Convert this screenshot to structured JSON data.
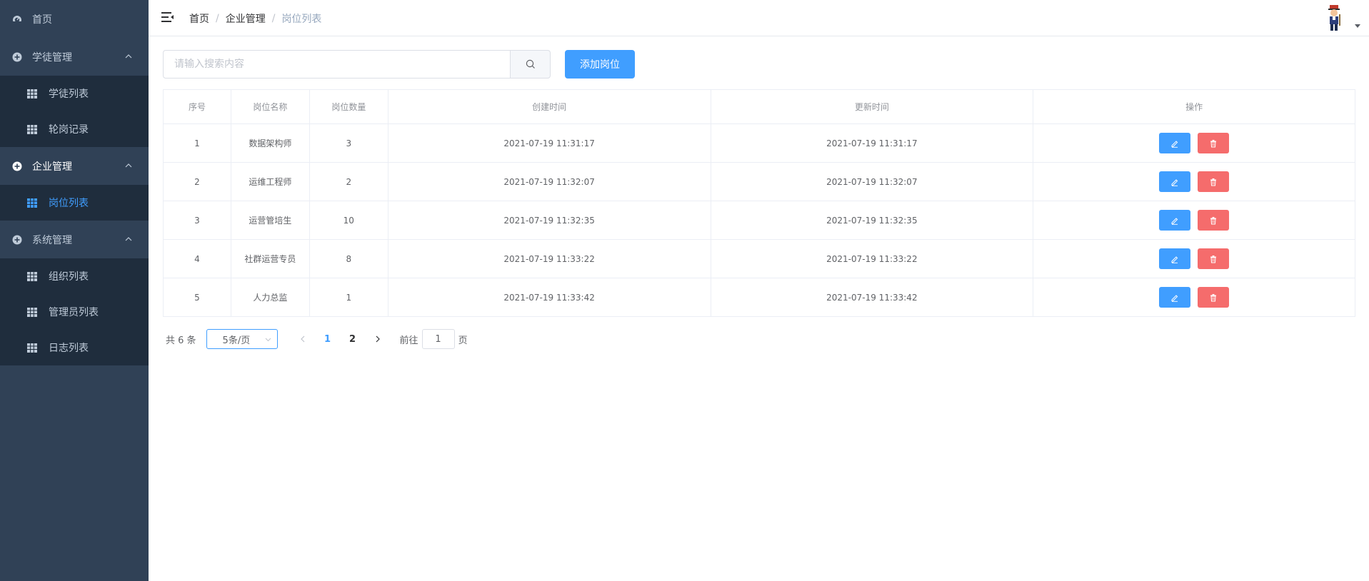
{
  "sidebar": {
    "home": {
      "label": "首页",
      "icon": "dashboard-icon"
    },
    "groups": [
      {
        "label": "学徒管理",
        "icon": "circle-plus-icon",
        "items": [
          {
            "label": "学徒列表",
            "icon": "table-icon"
          },
          {
            "label": "轮岗记录",
            "icon": "table-icon"
          }
        ]
      },
      {
        "label": "企业管理",
        "icon": "circle-plus-icon",
        "items": [
          {
            "label": "岗位列表",
            "icon": "table-icon",
            "active": true
          }
        ]
      },
      {
        "label": "系统管理",
        "icon": "circle-plus-icon",
        "items": [
          {
            "label": "组织列表",
            "icon": "table-icon"
          },
          {
            "label": "管理员列表",
            "icon": "table-icon"
          },
          {
            "label": "日志列表",
            "icon": "table-icon"
          }
        ]
      }
    ]
  },
  "breadcrumb": {
    "items": [
      "首页",
      "企业管理",
      "岗位列表"
    ],
    "separator": "/"
  },
  "search": {
    "placeholder": "请输入搜索内容",
    "value": ""
  },
  "toolbar": {
    "add_label": "添加岗位"
  },
  "table": {
    "headers": [
      "序号",
      "岗位名称",
      "岗位数量",
      "创建时间",
      "更新时间",
      "操作"
    ],
    "rows": [
      [
        "1",
        "数据架构师",
        "3",
        "2021-07-19 11:31:17",
        "2021-07-19 11:31:17"
      ],
      [
        "2",
        "运维工程师",
        "2",
        "2021-07-19 11:32:07",
        "2021-07-19 11:32:07"
      ],
      [
        "3",
        "运营管培生",
        "10",
        "2021-07-19 11:32:35",
        "2021-07-19 11:32:35"
      ],
      [
        "4",
        "社群运营专员",
        "8",
        "2021-07-19 11:33:22",
        "2021-07-19 11:33:22"
      ],
      [
        "5",
        "人力总监",
        "1",
        "2021-07-19 11:33:42",
        "2021-07-19 11:33:42"
      ]
    ]
  },
  "pagination": {
    "total_text": "共 6 条",
    "page_size": "5条/页",
    "pages": [
      "1",
      "2"
    ],
    "current_page": "1",
    "goto_label": "前往",
    "goto_value": "1",
    "page_suffix": "页"
  },
  "colors": {
    "primary": "#409eff",
    "danger": "#f56c6c",
    "sidebar": "#304156",
    "submenu": "#1f2d3d"
  }
}
